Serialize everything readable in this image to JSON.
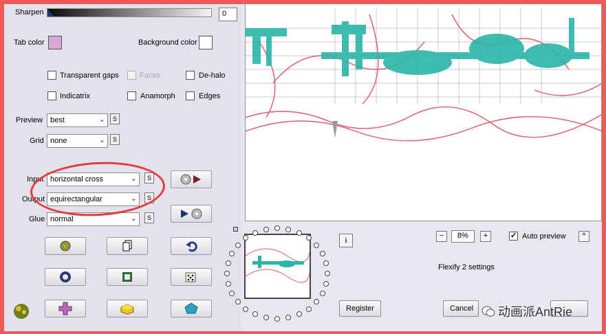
{
  "sharpen": {
    "label": "Sharpen",
    "value": "0",
    "level": 0
  },
  "colors": {
    "tab_label": "Tab color",
    "tab_color": "#d9a8d8",
    "bg_label": "Background color",
    "bg_color": "#ffffff"
  },
  "checkboxes": {
    "transparent_gaps": {
      "label": "Transparent gaps",
      "checked": false
    },
    "faces": {
      "label": "Faces",
      "checked": false,
      "disabled": true
    },
    "dehalo": {
      "label": "De-halo",
      "checked": false
    },
    "indicatrix": {
      "label": "Indicatrix",
      "checked": false
    },
    "anamorph": {
      "label": "Anamorph",
      "checked": false
    },
    "edges": {
      "label": "Edges",
      "checked": false
    }
  },
  "selects": {
    "preview": {
      "label": "Preview",
      "value": "best"
    },
    "grid": {
      "label": "Grid",
      "value": "none"
    },
    "input": {
      "label": "Input",
      "value": "horizontal cross"
    },
    "output": {
      "label": "Output",
      "value": "equirectangular"
    },
    "glue": {
      "label": "Glue",
      "value": "normal"
    }
  },
  "s_label": "S",
  "zoom": {
    "minus": "−",
    "value": "8%",
    "plus": "+"
  },
  "auto_preview": {
    "label": "Auto preview",
    "checked": true
  },
  "collapse": "^",
  "settings_name": "Flexify 2 settings",
  "info": "i",
  "buttons": {
    "register": "Register",
    "cancel": "Cancel"
  },
  "watermark": "动画派AntRie",
  "colors_ui": {
    "accent_red": "#e53b3b",
    "teal": "#2bb5a8"
  }
}
